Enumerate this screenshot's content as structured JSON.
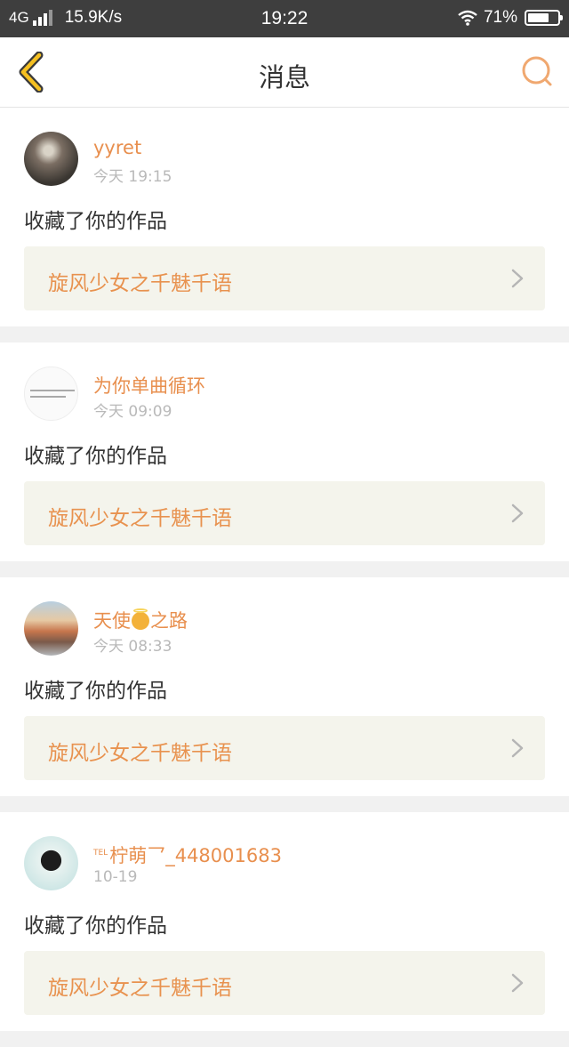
{
  "status_bar": {
    "network": "4G",
    "speed": "15.9K/s",
    "time": "19:22",
    "battery": "71%",
    "battery_level": 0.71
  },
  "header": {
    "title": "消息",
    "back_icon": "chevron-left-icon",
    "search_icon": "search-icon"
  },
  "colors": {
    "accent": "#e88f4e",
    "nav_icon": "#f5c021",
    "search_icon": "#f0a870"
  },
  "messages": [
    {
      "username": "yyret",
      "time": "今天 19:15",
      "action": "收藏了你的作品",
      "work_title": "旋风少女之千魅千语"
    },
    {
      "username": "为你单曲循环",
      "time": "今天 09:09",
      "action": "收藏了你的作品",
      "work_title": "旋风少女之千魅千语"
    },
    {
      "username_prefix": "天使",
      "username_suffix": "之路",
      "time": "今天 08:33",
      "action": "收藏了你的作品",
      "work_title": "旋风少女之千魅千语"
    },
    {
      "username_tag": "TEL",
      "username": "柠萌乛_448001683",
      "time": "10-19",
      "action": "收藏了你的作品",
      "work_title": "旋风少女之千魅千语"
    }
  ]
}
